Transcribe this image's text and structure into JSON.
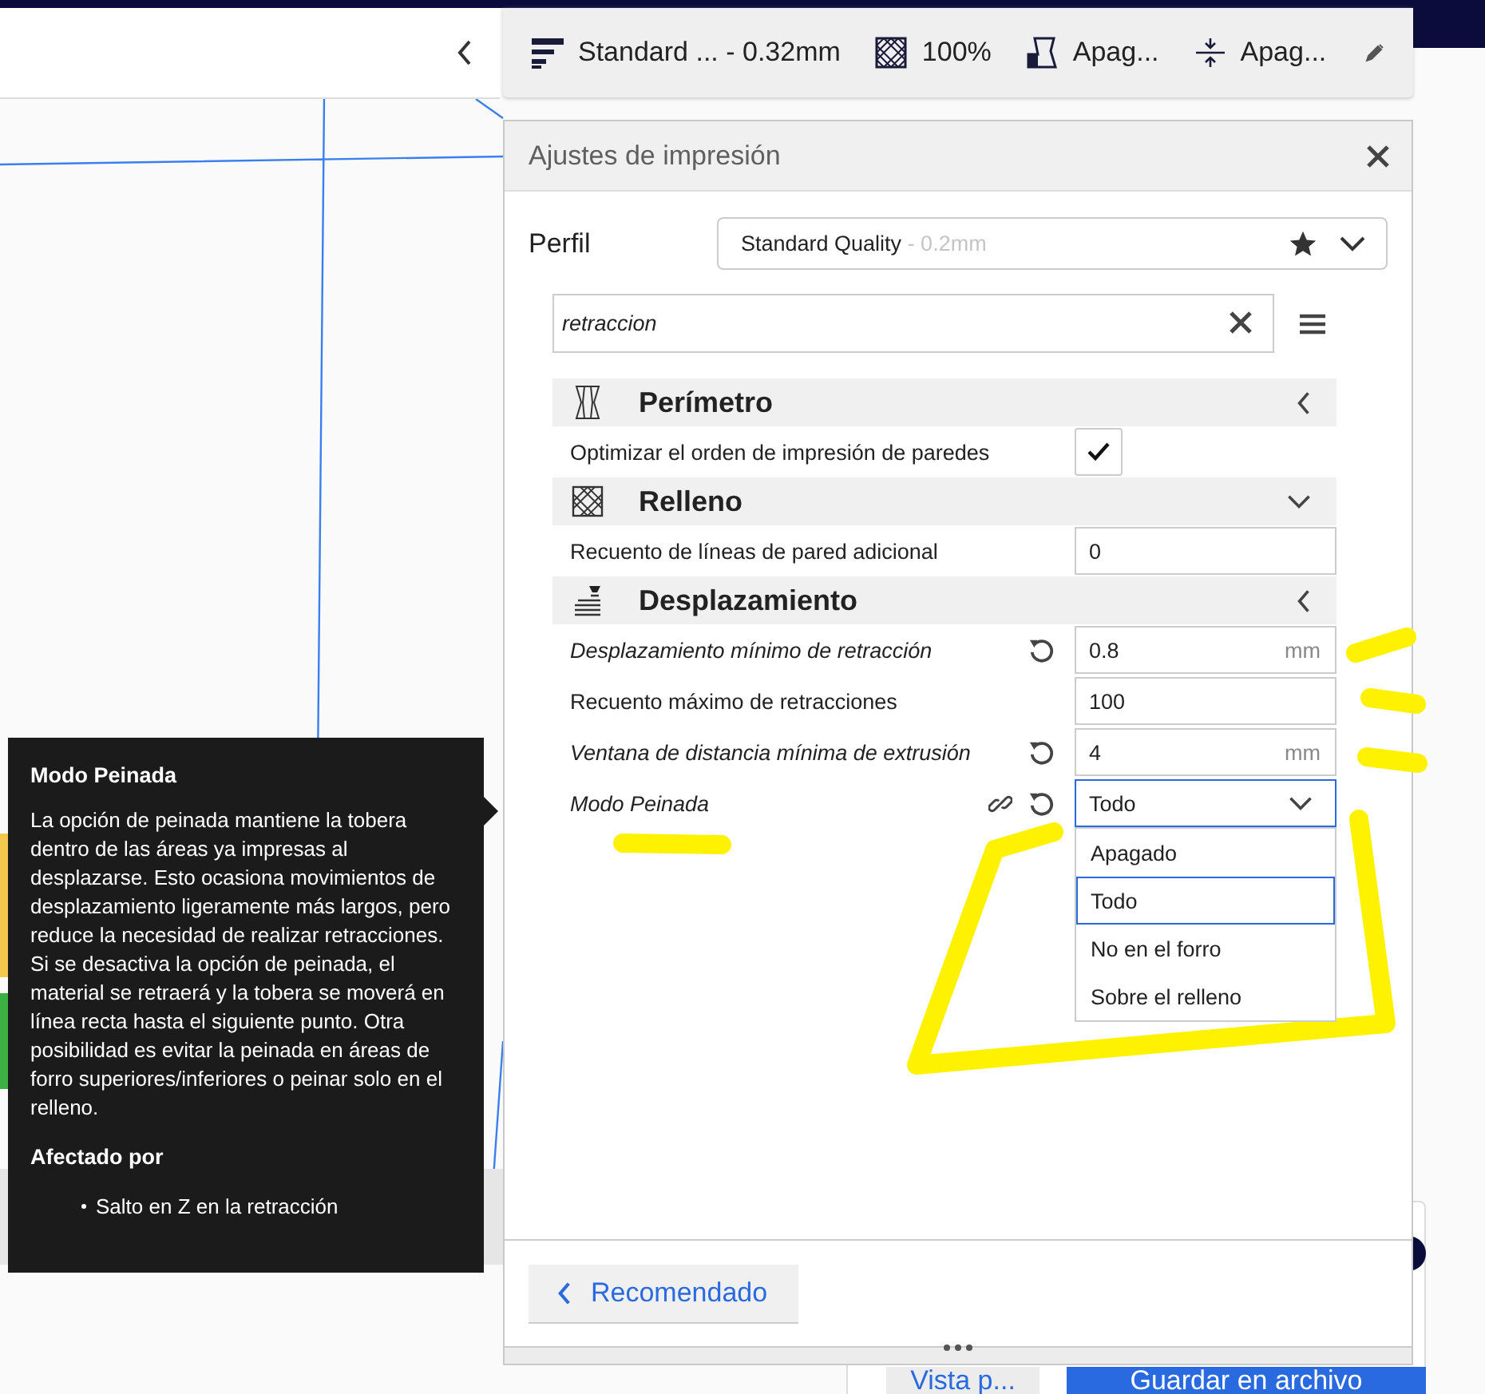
{
  "print_summary": {
    "profile": "Standard ... - 0.32mm",
    "infill": "100%",
    "support": "Apag...",
    "adhesion": "Apag..."
  },
  "print_settings": {
    "title": "Ajustes de impresión",
    "profile_label": "Perfil",
    "profile": {
      "name": "Standard Quality",
      "variant": "- 0.2mm"
    },
    "search": {
      "value": "retraccion"
    },
    "sections": [
      {
        "kind": "perimeter",
        "title": "Perímetro",
        "expanded": false,
        "settings": [
          {
            "kind": "checkbox",
            "label": "Optimizar el orden de impresión de paredes",
            "modified": false,
            "linked": false,
            "checked": true
          }
        ]
      },
      {
        "kind": "infill",
        "title": "Relleno",
        "expanded": true,
        "settings": [
          {
            "kind": "number",
            "label": "Recuento de líneas de pared adicional",
            "modified": false,
            "linked": false,
            "value": "0"
          }
        ]
      },
      {
        "kind": "travel",
        "title": "Desplazamiento",
        "expanded": false,
        "settings": [
          {
            "kind": "number",
            "label": "Desplazamiento mínimo de retracción",
            "modified": true,
            "linked": false,
            "value": "0.8",
            "unit": "mm"
          },
          {
            "kind": "number",
            "label": "Recuento máximo de retracciones",
            "modified": false,
            "linked": false,
            "value": "100"
          },
          {
            "kind": "number",
            "label": "Ventana de distancia mínima de extrusión",
            "modified": true,
            "linked": false,
            "value": "4",
            "unit": "mm"
          },
          {
            "kind": "dropdown",
            "label": "Modo Peinada",
            "modified": true,
            "linked": true,
            "value": "Todo",
            "open": true,
            "options": [
              {
                "label": "Apagado",
                "selected": false
              },
              {
                "label": "Todo",
                "selected": true
              },
              {
                "label": "No en el forro",
                "selected": false
              },
              {
                "label": "Sobre el relleno",
                "selected": false
              }
            ]
          }
        ]
      }
    ],
    "mode_button": "Recomendado"
  },
  "tooltip": {
    "title": "Modo Peinada",
    "body": "La opción de peinada mantiene la tobera dentro de las áreas ya impresas al desplazarse. Esto ocasiona movimientos de desplazamiento ligeramente más largos, pero reduce la necesidad de realizar retracciones. Si se desactiva la opción de peinada, el material se retraerá y la tobera se moverá en línea recta hasta el siguiente punto. Otra posibilidad es evitar la peinada en áreas de forro superiores/inferiores o peinar solo en el relleno.",
    "affected_heading": "Afectado por",
    "affected_items": [
      "Salto en Z en la retracción"
    ]
  },
  "output": {
    "preview_button": "Vista p...",
    "save_button": "Guardar en archivo"
  }
}
